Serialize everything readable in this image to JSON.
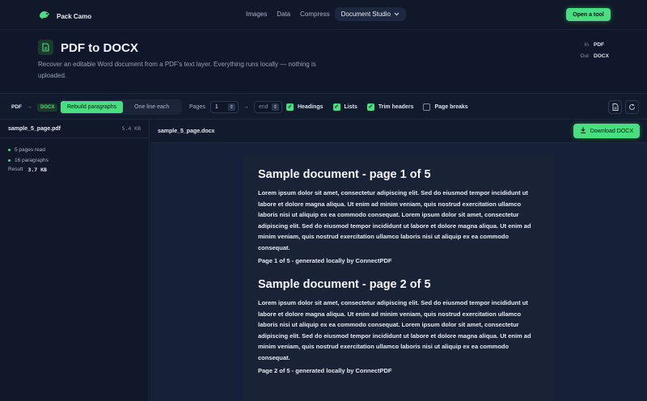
{
  "brand": {
    "name": "Pack Camo"
  },
  "nav": {
    "items": [
      "Images",
      "Data",
      "Compress"
    ],
    "active": "Document Studio",
    "cta": "Open a tool"
  },
  "hero": {
    "title": "PDF to DOCX",
    "description": "Recover an editable Word document from a PDF's text layer. Everything runs locally — nothing is uploaded.",
    "in_label": "In",
    "in_value": "PDF",
    "out_label": "Out",
    "out_value": "DOCX"
  },
  "toolbar": {
    "from": "PDF",
    "arrow": "→",
    "to": "DOCX",
    "mode_options": [
      "Rebuild paragraphs",
      "One line each"
    ],
    "mode_selected": "Rebuild paragraphs",
    "pages_label": "Pages",
    "page_start": "1",
    "page_arrow": "→",
    "page_end_placeholder": "end",
    "options": [
      {
        "label": "Headings",
        "checked": true
      },
      {
        "label": "Lists",
        "checked": true
      },
      {
        "label": "Trim headers",
        "checked": true
      },
      {
        "label": "Page breaks",
        "checked": false
      }
    ],
    "icons": [
      "file-icon",
      "reset-icon"
    ]
  },
  "input_file": {
    "name": "sample_5_page.pdf",
    "size": "5.4 KB",
    "stats": [
      "5 pages read",
      "16 paragraphs"
    ],
    "result_label": "Result",
    "result_value": "3.7 KB"
  },
  "output_file": {
    "name": "sample_5_page.docx",
    "download_label": "Download DOCX"
  },
  "document": {
    "pages": [
      {
        "heading": "Sample document - page 1 of 5",
        "body": "Lorem ipsum dolor sit amet, consectetur adipiscing elit. Sed do eiusmod tempor incididunt ut labore et dolore magna aliqua. Ut enim ad minim veniam, quis nostrud exercitation ullamco laboris nisi ut aliquip ex ea commodo consequat. Lorem ipsum dolor sit amet, consectetur adipiscing elit. Sed do eiusmod tempor incididunt ut labore et dolore magna aliqua. Ut enim ad minim veniam, quis nostrud exercitation ullamco laboris nisi ut aliquip ex ea commodo consequat.",
        "footer": "Page 1 of 5 - generated locally by ConnectPDF"
      },
      {
        "heading": "Sample document - page 2 of 5",
        "body": "Lorem ipsum dolor sit amet, consectetur adipiscing elit. Sed do eiusmod tempor incididunt ut labore et dolore magna aliqua. Ut enim ad minim veniam, quis nostrud exercitation ullamco laboris nisi ut aliquip ex ea commodo consequat. Lorem ipsum dolor sit amet, consectetur adipiscing elit. Sed do eiusmod tempor incididunt ut labore et dolore magna aliqua. Ut enim ad minim veniam, quis nostrud exercitation ullamco laboris nisi ut aliquip ex ea commodo consequat.",
        "footer": "Page 2 of 5 - generated locally by ConnectPDF"
      }
    ]
  },
  "colors": {
    "accent": "#4ade80",
    "background": "#10172a",
    "panel": "#121a2d"
  }
}
